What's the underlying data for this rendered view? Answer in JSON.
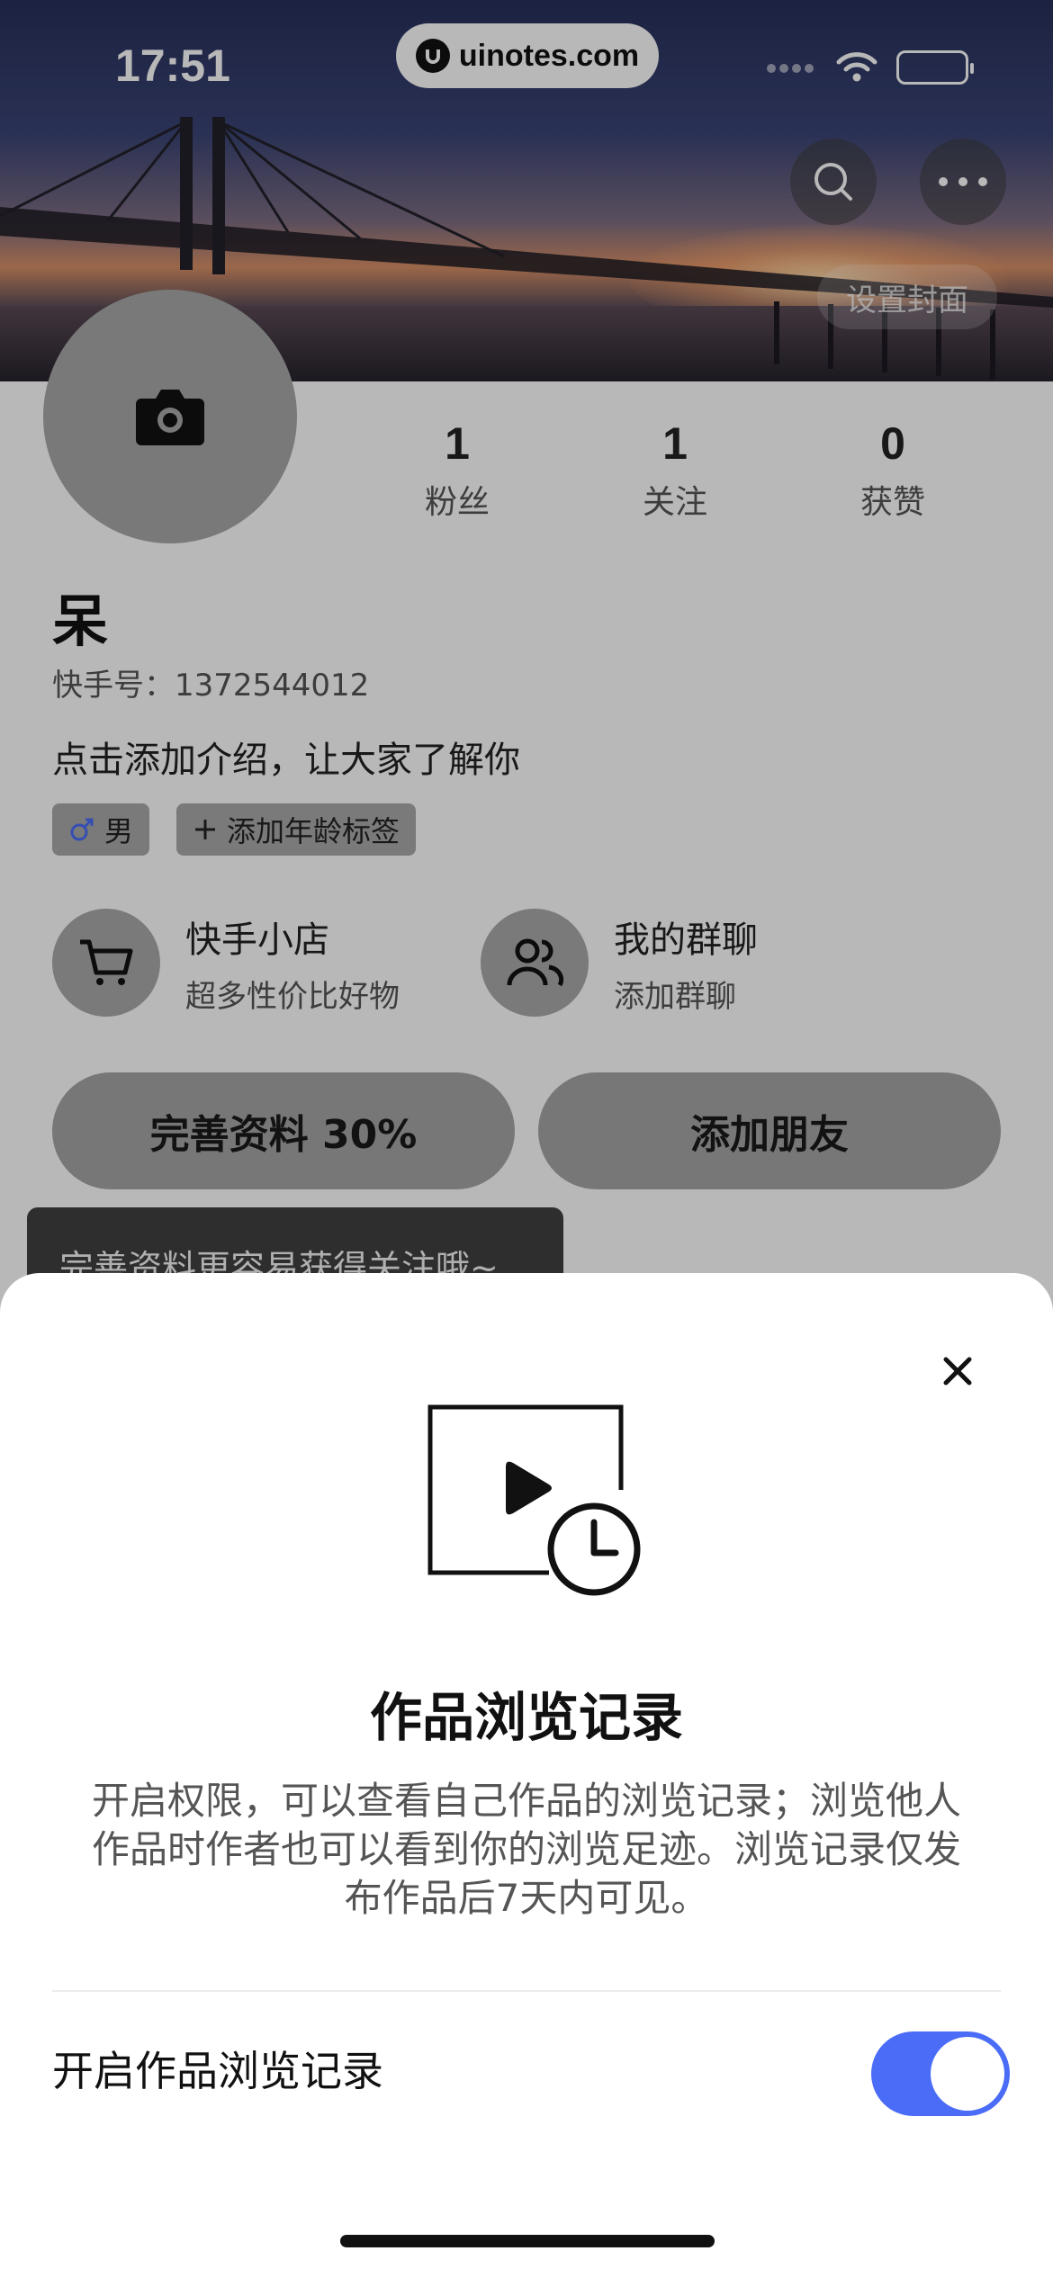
{
  "status_bar": {
    "time": "17:51",
    "url": "uinotes.com"
  },
  "cover": {
    "set_cover_label": "设置封面"
  },
  "stats": [
    {
      "value": "1",
      "label": "粉丝"
    },
    {
      "value": "1",
      "label": "关注"
    },
    {
      "value": "0",
      "label": "获赞"
    }
  ],
  "profile": {
    "name": "呆",
    "user_id": "快手号：1372544012",
    "bio": "点击添加介绍，让大家了解你",
    "gender_chip": "男",
    "age_chip": "添加年龄标签"
  },
  "features": [
    {
      "title": "快手小店",
      "subtitle": "超多性价比好物"
    },
    {
      "title": "我的群聊",
      "subtitle": "添加群聊"
    }
  ],
  "actions": {
    "complete_profile": "完善资料 30%",
    "add_friends": "添加朋友"
  },
  "tooltip": "完善资料更容易获得关注哦~",
  "sheet": {
    "title": "作品浏览记录",
    "description": "开启权限，可以查看自己作品的浏览记录；浏览他人作品时作者也可以看到你的浏览足迹。浏览记录仅发布作品后7天内可见。",
    "toggle_label": "开启作品浏览记录",
    "toggle_on": true
  },
  "colors": {
    "toggle_accent": "#4a6cf7",
    "gender_icon": "#4a6cf7"
  },
  "icons": [
    "camera-icon",
    "search-icon",
    "more-icon",
    "cart-icon",
    "group-chat-icon",
    "male-icon",
    "plus-icon",
    "close-icon",
    "video-history-icon"
  ]
}
